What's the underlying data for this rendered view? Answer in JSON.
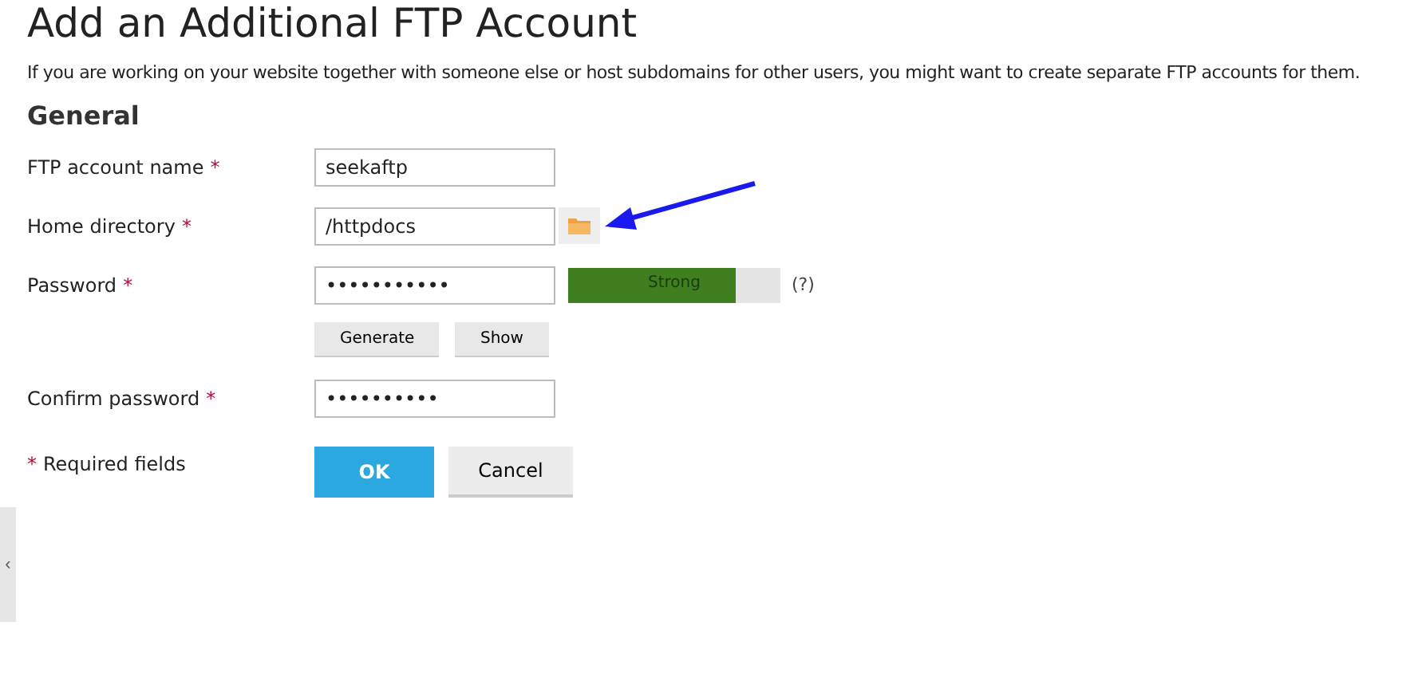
{
  "title": "Add an Additional FTP Account",
  "intro": "If you are working on your website together with someone else or host subdomains for other users, you might want to create separate FTP accounts for them.",
  "section": "General",
  "fields": [
    {
      "kind": "text",
      "label": "FTP account name",
      "mark": "*",
      "value": "seekaftp"
    },
    {
      "kind": "directory",
      "label": "Home directory",
      "mark": "*",
      "value": "/httpdocs"
    },
    {
      "kind": "password",
      "label": "Password",
      "mark": "*",
      "value": "•••••••••••",
      "strength": {
        "label": "Strong",
        "level": 0.79
      },
      "help": "(?)",
      "buttons": [
        "Generate",
        "Show"
      ]
    },
    {
      "kind": "text",
      "label": "Confirm password",
      "mark": "*",
      "value": "••••••••••"
    }
  ],
  "required_note": {
    "mark": "*",
    "text": "Required fields"
  },
  "actions": [
    {
      "kind": "primary",
      "label": "OK"
    },
    {
      "kind": "secondary",
      "label": "Cancel"
    }
  ],
  "side_toggle": "‹"
}
